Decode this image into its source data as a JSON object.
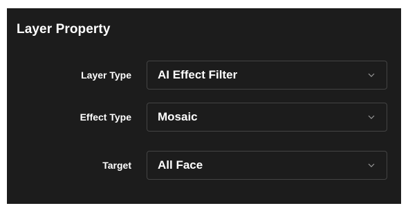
{
  "panel": {
    "title": "Layer Property"
  },
  "fields": [
    {
      "label": "Layer Type",
      "value": "AI Effect Filter",
      "icon": "chevron-down-icon"
    },
    {
      "label": "Effect Type",
      "value": "Mosaic",
      "icon": "chevron-down-icon"
    },
    {
      "label": "Target",
      "value": "All Face",
      "icon": "chevron-down-icon"
    }
  ],
  "colors": {
    "panel_background": "#1c1c1c",
    "text": "#ffffff",
    "dropdown_border": "#444444",
    "chevron": "#9a9a9a"
  }
}
